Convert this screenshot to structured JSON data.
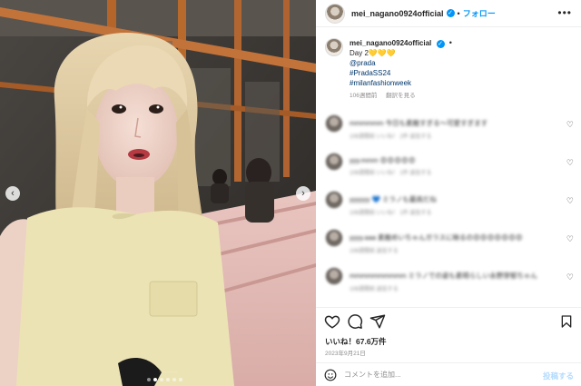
{
  "post": {
    "username": "mei_nagano0924official",
    "follow_label": "フォロー",
    "separator": "•",
    "more_label": "•••"
  },
  "caption": {
    "username": "mei_nagano0924official",
    "separator": "•",
    "lines": [
      "Day 2💛💛💛",
      "@prada",
      "#PradaSS24",
      "#milanfashionweek"
    ],
    "time_ago": "106週間前",
    "translate_label": "翻訳を見る"
  },
  "comments": [
    {
      "text": "mmmmmm 今日も素敵すぎる〜可愛すぎます",
      "meta": "106週間前   いいね！ 2件   返信する"
    },
    {
      "text": "yyy.mmm 😍😍😍😍😍",
      "meta": "106週間前   いいね！ 1件   返信する"
    },
    {
      "text": "yyyyyy 💙 ミラノも最高だね",
      "meta": "106週間前   いいね！ 1件   返信する"
    },
    {
      "text": "yyyy.aaa 素敵めいちゃんガラスに映るの😍😍😍😍😍😍😍",
      "meta": "106週間前   返信する"
    },
    {
      "text": "mmmmmmmmmm ミラノでの姿も素晴らしい永野芽郁ちゃん",
      "meta": "106週間前   返信する"
    }
  ],
  "stats": {
    "likes": "いいね！67.6万件",
    "date": "2023年9月21日"
  },
  "add_comment": {
    "placeholder": "コメントを追加...",
    "post_label": "投稿する"
  },
  "carousel": {
    "prev_icon": "‹",
    "next_icon": "›",
    "slide_count": 6,
    "active_slide": 2
  },
  "colors": {
    "link": "#00376b",
    "accent": "#0095f6",
    "muted": "#8e8e8e"
  }
}
